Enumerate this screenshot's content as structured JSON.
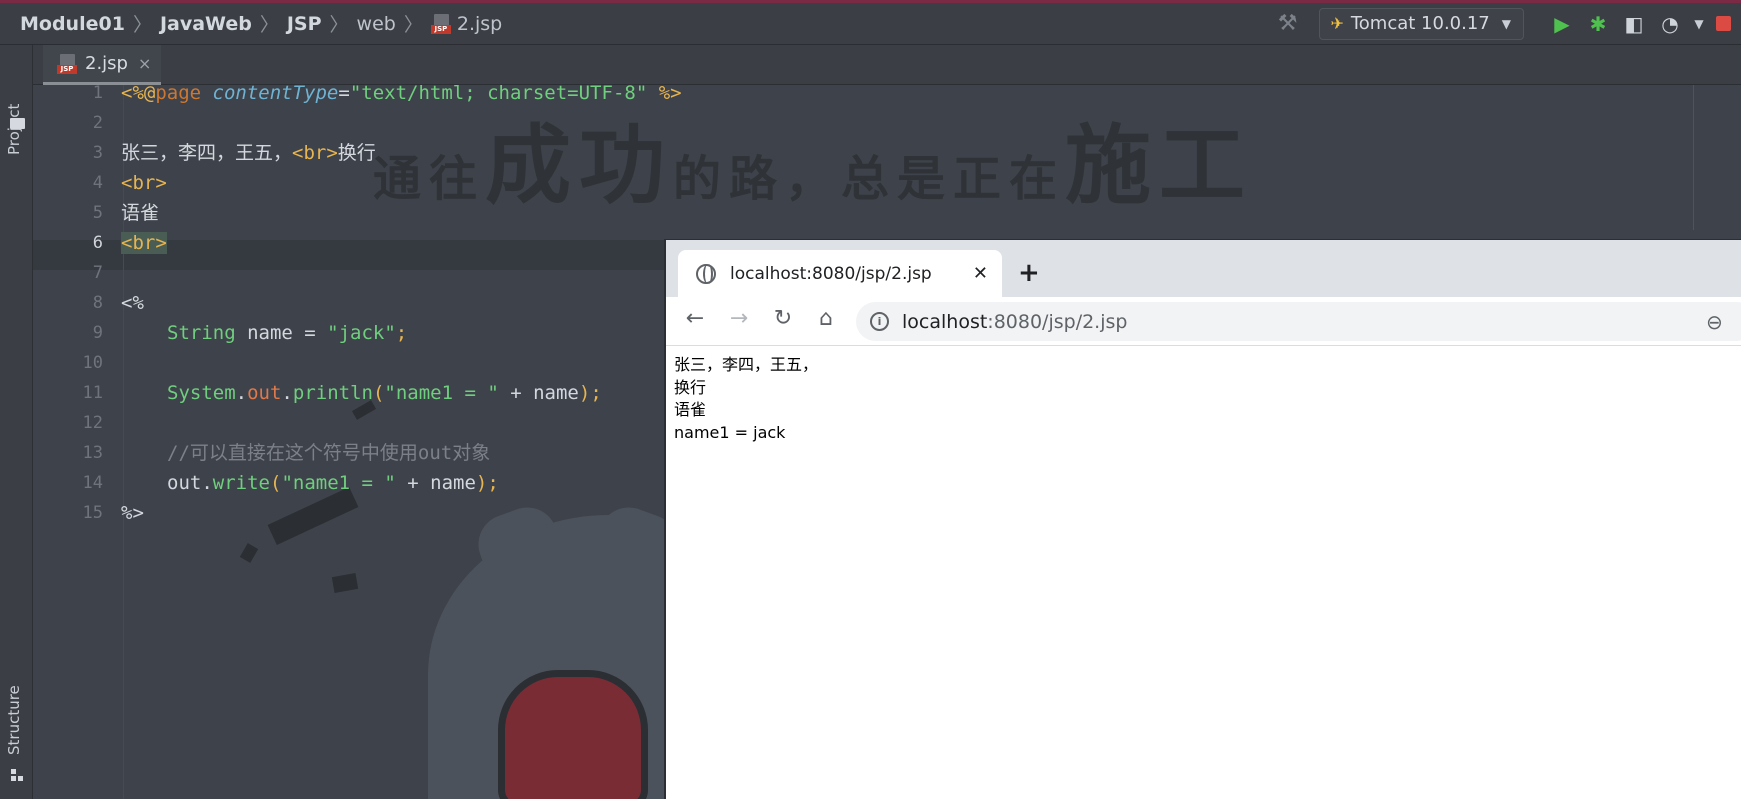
{
  "navbar": {
    "breadcrumbs": [
      "Module01",
      "JavaWeb",
      "JSP",
      "web",
      "2.jsp"
    ],
    "jsp_icon_label": "JSP",
    "run_config": "Tomcat 10.0.17"
  },
  "left_strip": {
    "project_label": "Project",
    "structure_label": "Structure"
  },
  "editor_tab": {
    "label": "2.jsp",
    "jsp_icon_label": "JSP",
    "close": "×"
  },
  "editor": {
    "active_line": 6,
    "line_numbers": [
      "1",
      "2",
      "3",
      "4",
      "5",
      "6",
      "7",
      "8",
      "9",
      "10",
      "11",
      "12",
      "13",
      "14",
      "15"
    ],
    "lines": {
      "l1": {
        "open": "<%@",
        "directive": "page",
        "attr": "contentType",
        "eq": "=",
        "value": "\"text/html; charset=UTF-8\"",
        "close": "%>"
      },
      "l3": {
        "text": "张三，李四，王五，",
        "tag": "<br>",
        "after": "换行"
      },
      "l4": {
        "tag": "<br>"
      },
      "l5": {
        "text": "语雀"
      },
      "l6": {
        "tag": "<br>"
      },
      "l8": {
        "text": "<%"
      },
      "l9": {
        "type": "String",
        "var": " name = ",
        "str": "\"jack\"",
        "semi": ";"
      },
      "l11": {
        "cls": "System",
        "dot1": ".",
        "field": "out",
        "dot2": ".",
        "method": "println",
        "lp": "(",
        "str": "\"name1 = \"",
        "plus": " + name",
        "rp": ")",
        "semi": ";"
      },
      "l13": {
        "comment": "//可以直接在这个符号中使用out对象"
      },
      "l14": {
        "obj": "out",
        "dot": ".",
        "method": "write",
        "lp": "(",
        "str": "\"name1 = \"",
        "plus": " + name",
        "rp": ")",
        "semi": ";"
      },
      "l15": {
        "text": "%>"
      }
    },
    "wallpaper_text": {
      "part1": "通往",
      "part2": "成功",
      "part3": "的路，总是正在",
      "part4": "施工"
    }
  },
  "browser": {
    "tab_title": "localhost:8080/jsp/2.jsp",
    "tab_close": "✕",
    "new_tab": "+",
    "url_host": "localhost",
    "url_path": ":8080/jsp/2.jsp",
    "content": [
      "张三，李四，王五，",
      "换行",
      "语雀",
      "name1 = jack"
    ]
  },
  "colors": {
    "editor_bg": "#3e424a",
    "string": "#6fcf7e",
    "tag": "#e6b450",
    "keyword": "#cc7832",
    "run_green": "#4fc14f",
    "stop_red": "#db4b43"
  }
}
